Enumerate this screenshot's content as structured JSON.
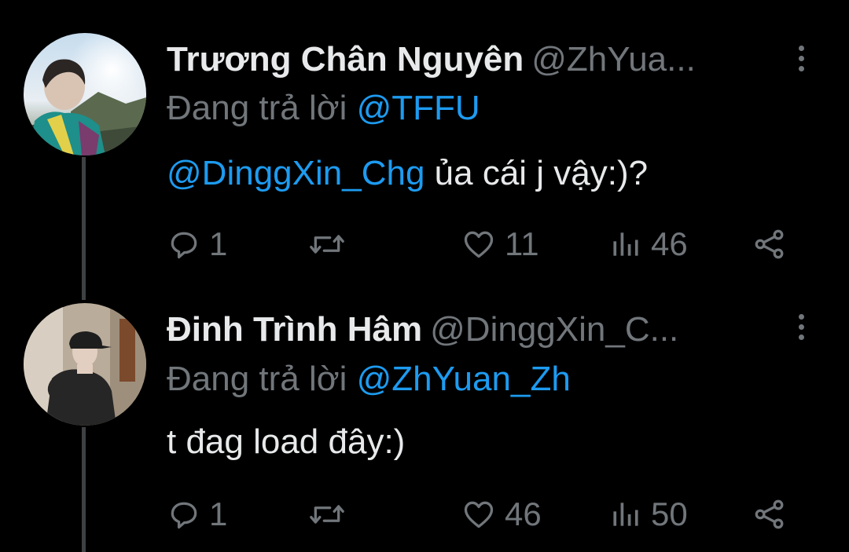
{
  "tweets": [
    {
      "display_name": "Trương Chân Nguyên",
      "handle": "@ZhYua...",
      "reply_prefix": "Đang trả lời",
      "reply_to": "@TFFU",
      "body_mention": "@DinggXin_Chg",
      "body_text": " ủa cái j vậy:)?",
      "replies": "1",
      "likes": "11",
      "views": "46"
    },
    {
      "display_name": "Đinh Trình Hâm",
      "handle": "@DinggXin_C...",
      "reply_prefix": "Đang trả lời",
      "reply_to": "@ZhYuan_Zh",
      "body_mention": "",
      "body_text": "t đag load đây:)",
      "replies": "1",
      "likes": "46",
      "views": "50"
    }
  ],
  "icons": {
    "reply": "speech-bubble-icon",
    "retweet": "retweet-arrows-icon",
    "like": "heart-icon",
    "views": "bar-chart-icon",
    "share": "share-nodes-icon",
    "more": "vertical-ellipsis-icon"
  },
  "colors": {
    "background": "#000000",
    "primary_text": "#e7e9ea",
    "secondary_text": "#71767b",
    "link": "#1d9bf0",
    "thread_line": "#3e4144"
  }
}
